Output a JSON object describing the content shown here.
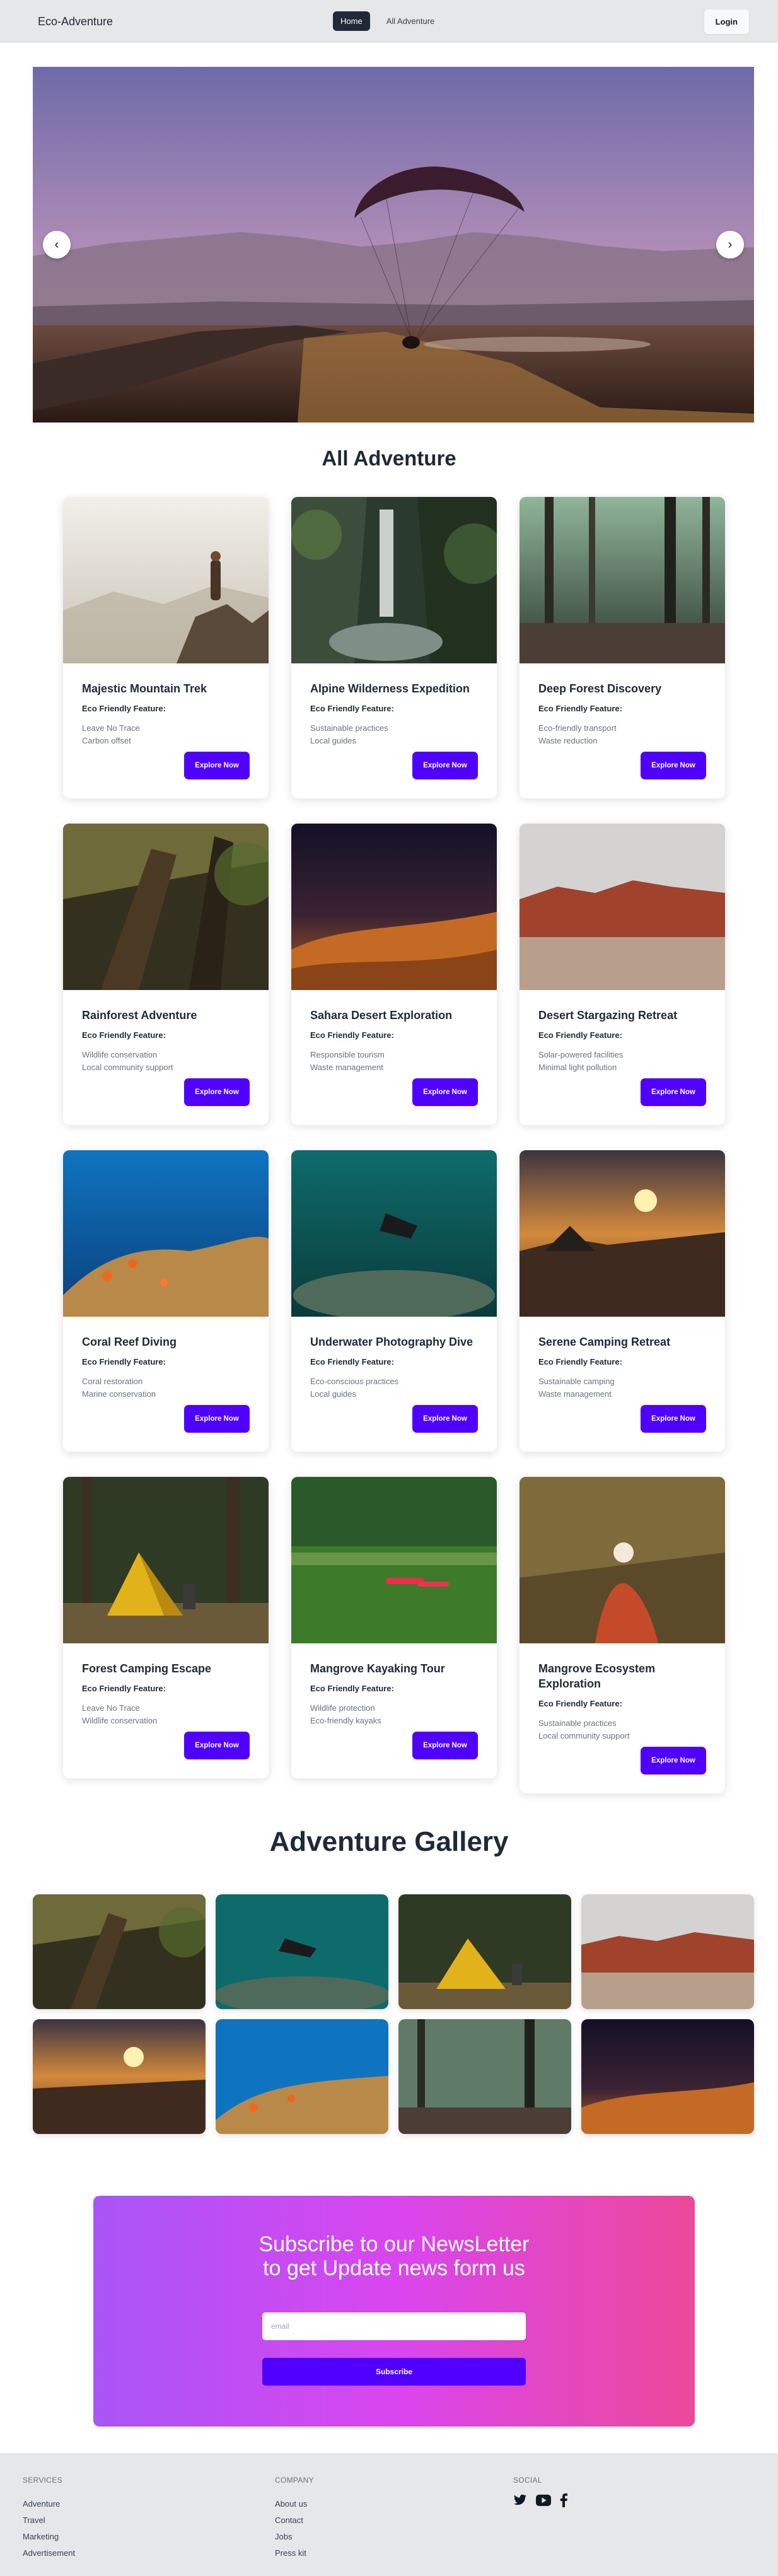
{
  "nav": {
    "brand": "Eco-Adventure",
    "links": [
      "Home",
      "All Adventure"
    ],
    "login": "Login"
  },
  "carousel": {
    "prev": "‹",
    "next": "›"
  },
  "sections": {
    "adventures_title": "All Adventure",
    "gallery_title": "Adventure Gallery"
  },
  "cards": [
    {
      "title": "Majestic Mountain Trek",
      "feature_label": "Eco Friendly Feature:",
      "features": [
        "Leave No Trace",
        "Carbon offset"
      ],
      "button": "Explore Now"
    },
    {
      "title": "Alpine Wilderness Expedition",
      "feature_label": "Eco Friendly Feature:",
      "features": [
        "Sustainable practices",
        "Local guides"
      ],
      "button": "Explore Now"
    },
    {
      "title": "Deep Forest Discovery",
      "feature_label": "Eco Friendly Feature:",
      "features": [
        "Eco-friendly transport",
        "Waste reduction"
      ],
      "button": "Explore Now"
    },
    {
      "title": "Rainforest Adventure",
      "feature_label": "Eco Friendly Feature:",
      "features": [
        "Wildlife conservation",
        "Local community support"
      ],
      "button": "Explore Now"
    },
    {
      "title": "Sahara Desert Exploration",
      "feature_label": "Eco Friendly Feature:",
      "features": [
        "Responsible tourism",
        "Waste management"
      ],
      "button": "Explore Now"
    },
    {
      "title": "Desert Stargazing Retreat",
      "feature_label": "Eco Friendly Feature:",
      "features": [
        "Solar-powered facilities",
        "Minimal light pollution"
      ],
      "button": "Explore Now"
    },
    {
      "title": "Coral Reef Diving",
      "feature_label": "Eco Friendly Feature:",
      "features": [
        "Coral restoration",
        "Marine conservation"
      ],
      "button": "Explore Now"
    },
    {
      "title": "Underwater Photography Dive",
      "feature_label": "Eco Friendly Feature:",
      "features": [
        "Eco-conscious practices",
        "Local guides"
      ],
      "button": "Explore Now"
    },
    {
      "title": "Serene Camping Retreat",
      "feature_label": "Eco Friendly Feature:",
      "features": [
        "Sustainable camping",
        "Waste management"
      ],
      "button": "Explore Now"
    },
    {
      "title": "Forest Camping Escape",
      "feature_label": "Eco Friendly Feature:",
      "features": [
        "Leave No Trace",
        "Wildlife conservation"
      ],
      "button": "Explore Now"
    },
    {
      "title": "Mangrove Kayaking Tour",
      "feature_label": "Eco Friendly Feature:",
      "features": [
        "Wildlife protection",
        "Eco-friendly kayaks"
      ],
      "button": "Explore Now"
    },
    {
      "title": "Mangrove Ecosystem Exploration",
      "feature_label": "Eco Friendly Feature:",
      "features": [
        "Sustainable practices",
        "Local community support"
      ],
      "button": "Explore Now"
    }
  ],
  "newsletter": {
    "title_line1": "Subscribe to our NewsLetter",
    "title_line2": "to get Update news form us",
    "placeholder": "email",
    "button": "Subscribe"
  },
  "footer": {
    "services": {
      "heading": "SERVICES",
      "items": [
        "Adventure",
        "Travel",
        "Marketing",
        "Advertisement"
      ]
    },
    "company": {
      "heading": "COMPANY",
      "items": [
        "About us",
        "Contact",
        "Jobs",
        "Press kit"
      ]
    },
    "social": {
      "heading": "SOCIAL",
      "icons": [
        "twitter-icon",
        "youtube-icon",
        "facebook-icon"
      ]
    }
  },
  "colors": {
    "accent": "#4f00ff",
    "nav_bg": "#e5e7e8",
    "gradient_start": "#a855f7",
    "gradient_end": "#ec4899"
  }
}
